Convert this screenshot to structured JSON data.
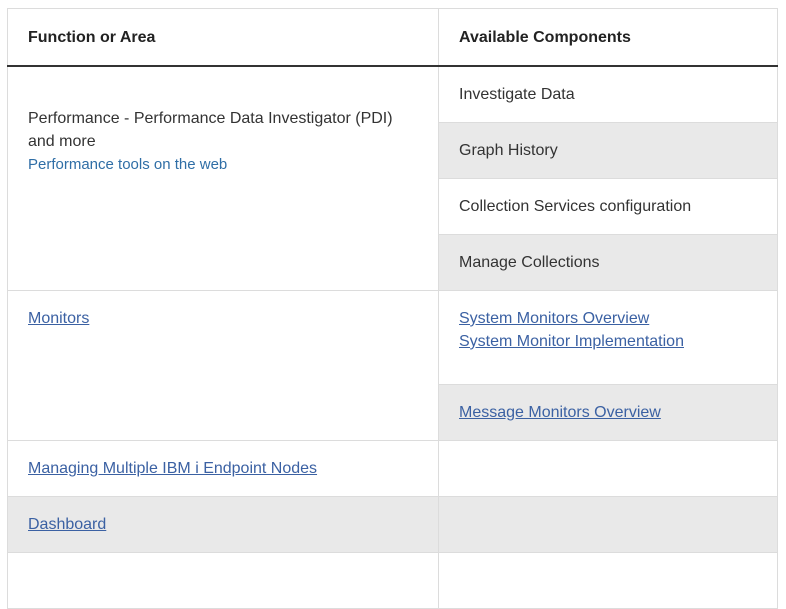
{
  "table": {
    "headers": [
      "Function or Area",
      "Available Components"
    ],
    "rows": {
      "performance": {
        "area_text": "Performance - Performance Data Investigator (PDI) and more",
        "area_link": "Performance tools on the web",
        "components": [
          "Investigate Data",
          "Graph History",
          "Collection Services configuration",
          "Manage Collections"
        ]
      },
      "monitors": {
        "area_link": "Monitors",
        "components": [
          "System Monitors Overview",
          "System Monitor Implementation",
          "Message Monitors Overview"
        ]
      },
      "multiple_nodes": {
        "area_link": "Managing Multiple IBM i Endpoint Nodes"
      },
      "dashboard": {
        "area_link": "Dashboard"
      }
    }
  }
}
